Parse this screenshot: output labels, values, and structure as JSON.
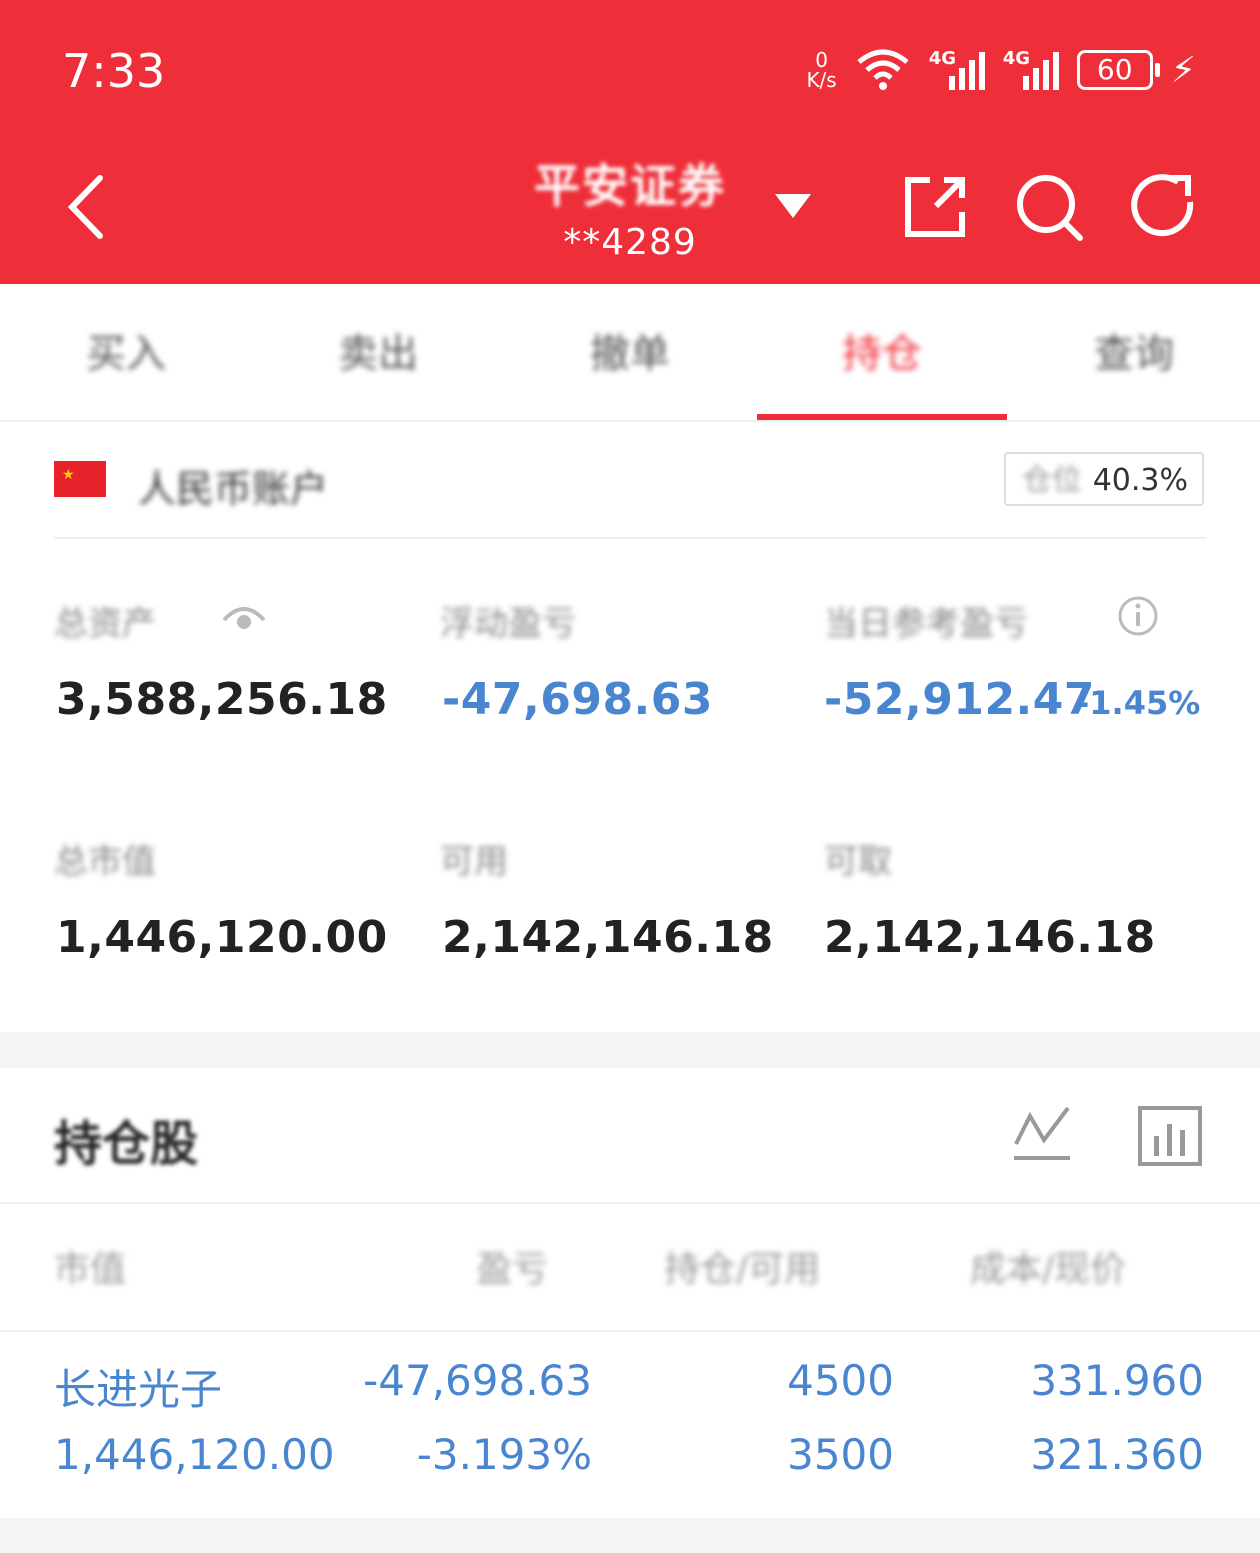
{
  "status_bar": {
    "time": "7:33",
    "net_speed_value": "0",
    "net_speed_unit": "K/s",
    "signal_1_label": "4G",
    "signal_2_label": "4G",
    "battery": "60"
  },
  "header": {
    "broker": "平安证券",
    "account": "**4289"
  },
  "tabs": [
    {
      "label": "买入"
    },
    {
      "label": "卖出"
    },
    {
      "label": "撤单"
    },
    {
      "label": "持仓"
    },
    {
      "label": "查询"
    }
  ],
  "account_row": {
    "label": "人民币账户",
    "ratio_label": "仓位",
    "ratio_value": "40.3%"
  },
  "metrics": {
    "total_assets": {
      "label": "总资产",
      "value": "3,588,256.18"
    },
    "floating_pnl": {
      "label": "浮动盈亏",
      "value": "-47,698.63"
    },
    "today_pnl": {
      "label": "当日参考盈亏",
      "value": "-52,912.47",
      "pct": "-1.45%"
    },
    "market_value": {
      "label": "总市值",
      "value": "1,446,120.00"
    },
    "available": {
      "label": "可用",
      "value": "2,142,146.18"
    },
    "withdrawable": {
      "label": "可取",
      "value": "2,142,146.18"
    }
  },
  "holdings": {
    "title": "持仓股",
    "columns": [
      "市值",
      "盈亏",
      "持仓/可用",
      "成本/现价"
    ],
    "rows": [
      {
        "name": "长进光子",
        "market_value": "1,446,120.00",
        "pnl": "-47,698.63",
        "pnl_pct": "-3.193%",
        "position": "4500",
        "available": "3500",
        "cost": "331.960",
        "price": "321.360"
      }
    ]
  },
  "colors": {
    "brand_red": "#ee2f39",
    "loss_blue": "#4a86cf"
  }
}
